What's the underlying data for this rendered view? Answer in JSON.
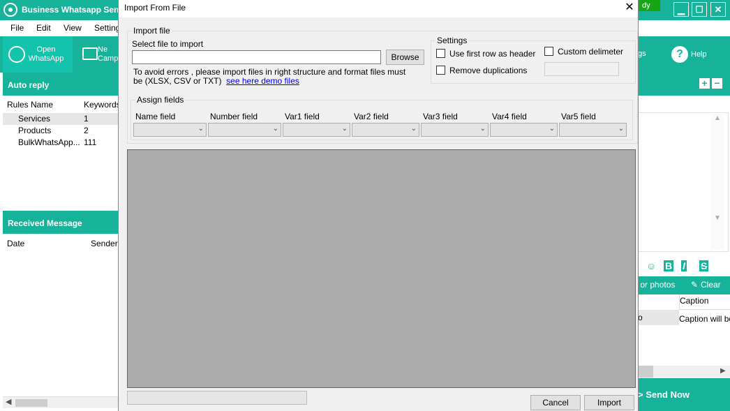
{
  "app": {
    "title": "Business Whatsapp Sen",
    "status": "dy",
    "window_buttons": {
      "minimize": "▁",
      "maximize": "☐",
      "close": "✕"
    },
    "menu": [
      "File",
      "Edit",
      "View",
      "Setting"
    ],
    "toolbar": {
      "open_label": "Open\nWhatsApp",
      "camp_label": "Ne\nCamp",
      "settings_fragment": "gs",
      "help_label": "Help",
      "help_icon": "?"
    },
    "auto_reply": {
      "header": "Auto reply",
      "columns": [
        "Rules Name",
        "Keywords"
      ],
      "rows": [
        {
          "name": "Services",
          "keywords": "1"
        },
        {
          "name": "Products",
          "keywords": "2"
        },
        {
          "name": "BulkWhatsApp...",
          "keywords": "111"
        }
      ]
    },
    "received": {
      "header": "Received Message",
      "columns": [
        "Date",
        "Sender"
      ]
    },
    "right_panel": {
      "add_icon": "+",
      "remove_icon": "−",
      "format": {
        "emoji": "☺",
        "bold": "B",
        "italic": "I",
        "strike": "S"
      },
      "photos_label": "s or photos",
      "clear_label": "Clear",
      "table_header": "Caption",
      "table_cell_left": "o",
      "table_cell": "Caption will be",
      "send_now": "> Send Now"
    }
  },
  "dialog": {
    "title": "Import From File",
    "close_glyph": "✕",
    "import_file": {
      "group_label": "Import file",
      "select_label": "Select file to import",
      "file_value": "",
      "browse_label": "Browse",
      "note_line1": "To avoid errors , please import files in right structure and format files must",
      "note_line2": "be (XLSX, CSV or TXT)",
      "demo_link": "see here demo files"
    },
    "settings": {
      "group_label": "Settings",
      "use_first_row": "Use first row as header",
      "remove_dup": "Remove duplications",
      "custom_delim": "Custom delimeter",
      "delim_value": ""
    },
    "assign_fields": {
      "group_label": "Assign fields",
      "fields": [
        "Name field",
        "Number field",
        "Var1 field",
        "Var2 field",
        "Var3 field",
        "Var4 field",
        "Var5 field"
      ]
    },
    "buttons": {
      "cancel": "Cancel",
      "import": "Import"
    },
    "progress": 0
  }
}
